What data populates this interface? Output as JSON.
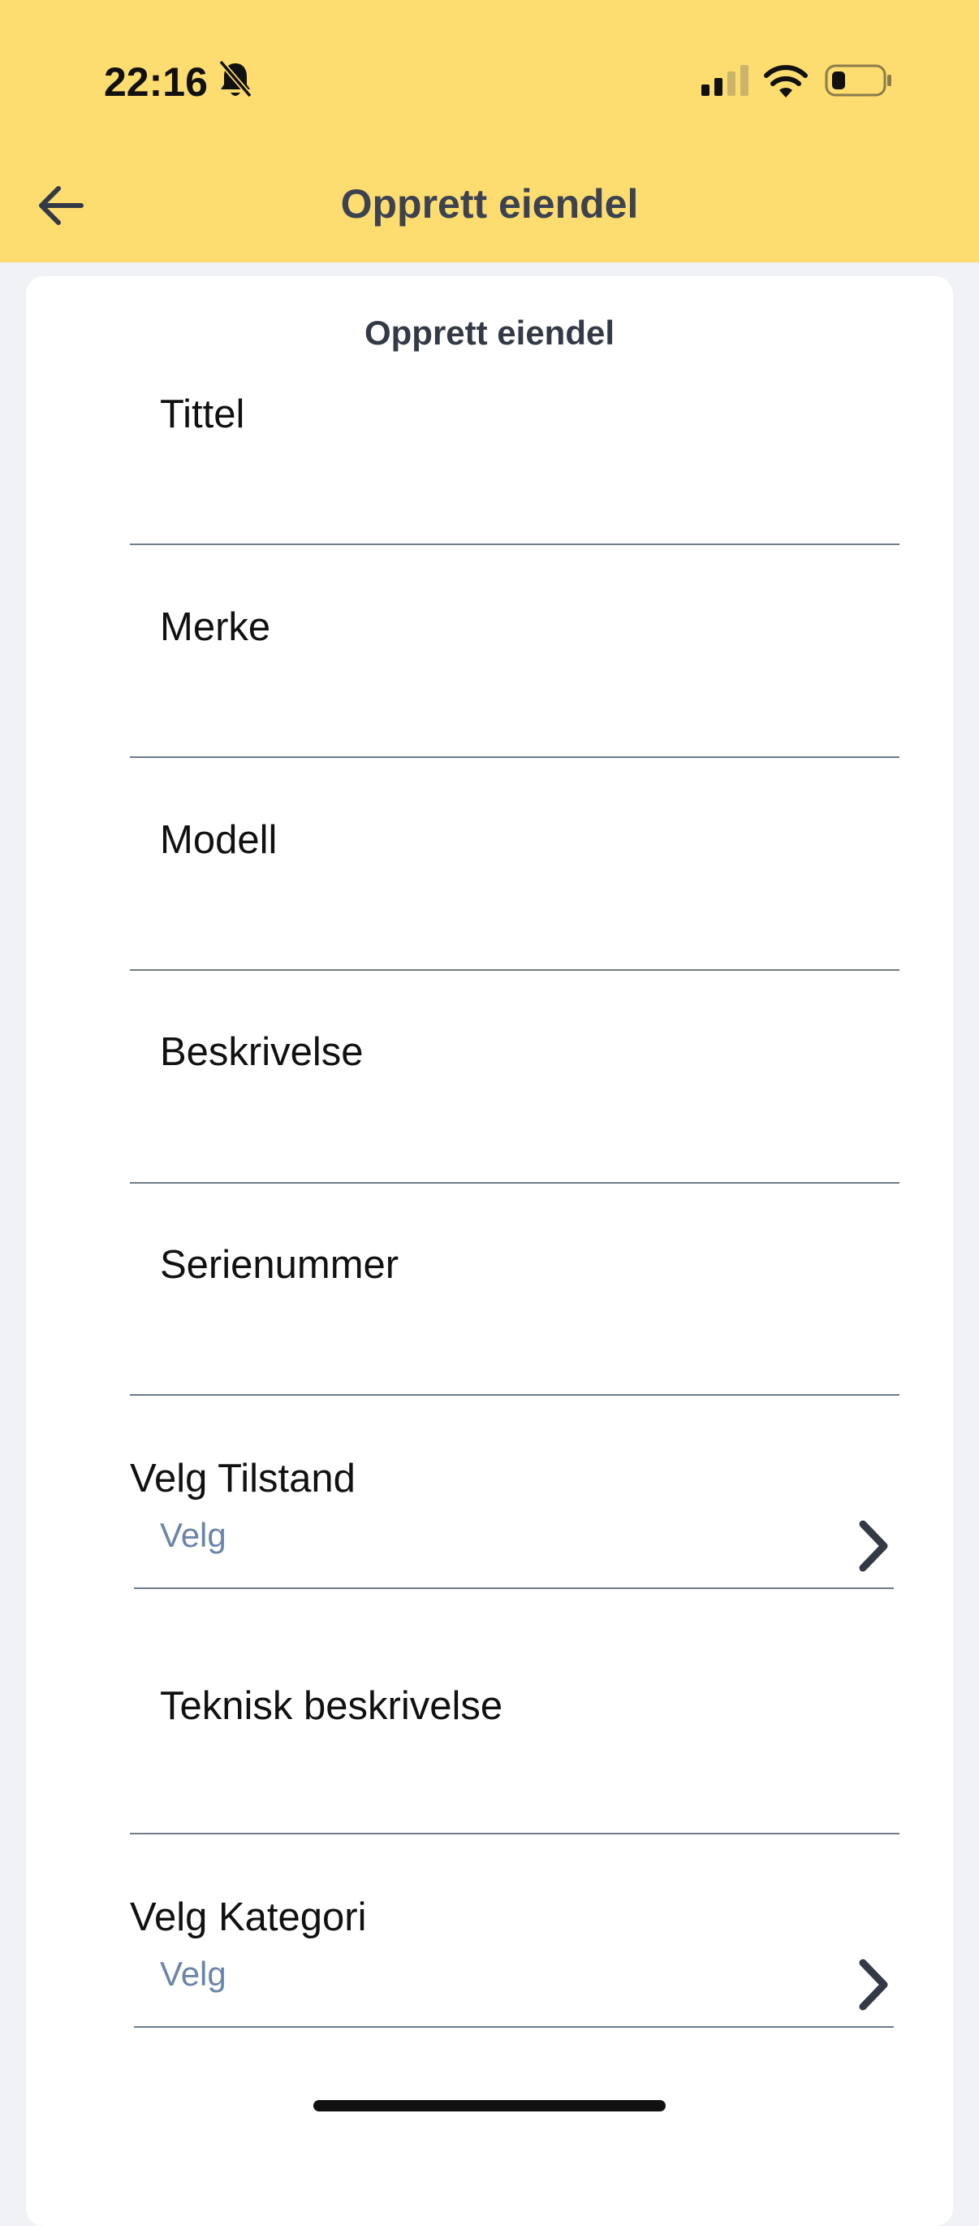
{
  "status_bar": {
    "time": "22:16"
  },
  "header": {
    "title": "Opprett eiendel"
  },
  "form": {
    "title": "Opprett eiendel",
    "fields": [
      {
        "label": "Tittel"
      },
      {
        "label": "Merke"
      },
      {
        "label": "Modell"
      },
      {
        "label": "Beskrivelse"
      },
      {
        "label": "Serienummer"
      }
    ],
    "condition_select": {
      "label": "Velg Tilstand",
      "value": "Velg"
    },
    "technical_field": {
      "label": "Teknisk beskrivelse"
    },
    "category_select": {
      "label": "Velg Kategori",
      "value": "Velg"
    }
  },
  "colors": {
    "header_bg": "#fddc70",
    "page_bg": "#f1f2f6",
    "select_placeholder": "#6b85a8",
    "divider": "#6e7c8a"
  },
  "icons": [
    "bell-slash-icon",
    "cellular-signal-icon",
    "wifi-icon",
    "battery-icon",
    "arrow-left-icon",
    "chevron-right-icon"
  ]
}
